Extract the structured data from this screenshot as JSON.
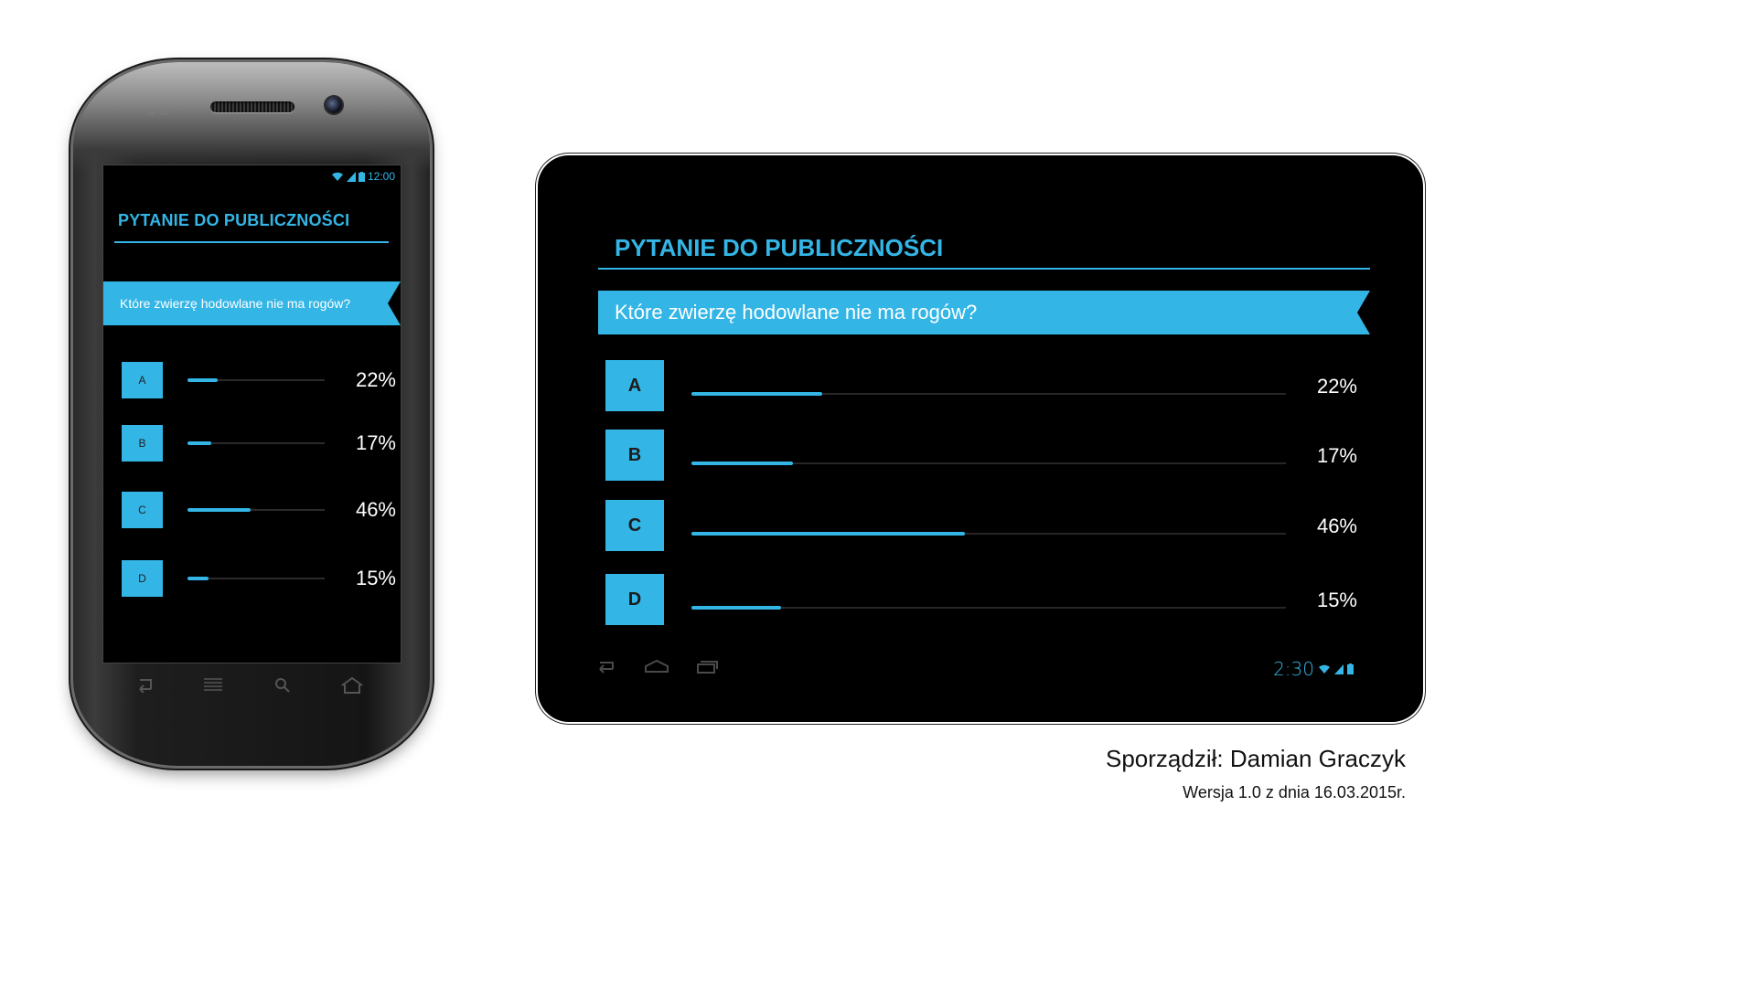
{
  "phone": {
    "status_time": "12:00",
    "title": "PYTANIE DO PUBLICZNOŚCI",
    "question": "Które zwierzę hodowlane nie ma rogów?",
    "answers": [
      {
        "letter": "A",
        "percent_label": "22%",
        "value": 0.22
      },
      {
        "letter": "B",
        "percent_label": "17%",
        "value": 0.17
      },
      {
        "letter": "C",
        "percent_label": "46%",
        "value": 0.46
      },
      {
        "letter": "D",
        "percent_label": "15%",
        "value": 0.15
      }
    ]
  },
  "tablet": {
    "title": "PYTANIE DO PUBLICZNOŚCI",
    "question": "Które zwierzę hodowlane nie ma rogów?",
    "clock": "2:30",
    "answers": [
      {
        "letter": "A",
        "percent_label": "22%",
        "value": 0.22
      },
      {
        "letter": "B",
        "percent_label": "17%",
        "value": 0.17
      },
      {
        "letter": "C",
        "percent_label": "46%",
        "value": 0.46
      },
      {
        "letter": "D",
        "percent_label": "15%",
        "value": 0.15
      }
    ]
  },
  "credits": {
    "author": "Sporządził: Damian Graczyk",
    "version": "Wersja 1.0 z dnia 16.03.2015r."
  },
  "colors": {
    "accent": "#33b5e5",
    "screen_bg": "#000000"
  },
  "icons": {
    "phone_status": [
      "wifi-icon",
      "signal-icon",
      "battery-icon"
    ],
    "phone_nav": [
      "back-icon",
      "menu-icon",
      "search-icon",
      "home-icon"
    ],
    "tablet_nav": [
      "back-icon",
      "home-icon",
      "recent-apps-icon"
    ],
    "tablet_status": [
      "wifi-icon",
      "signal-icon",
      "battery-icon"
    ]
  }
}
